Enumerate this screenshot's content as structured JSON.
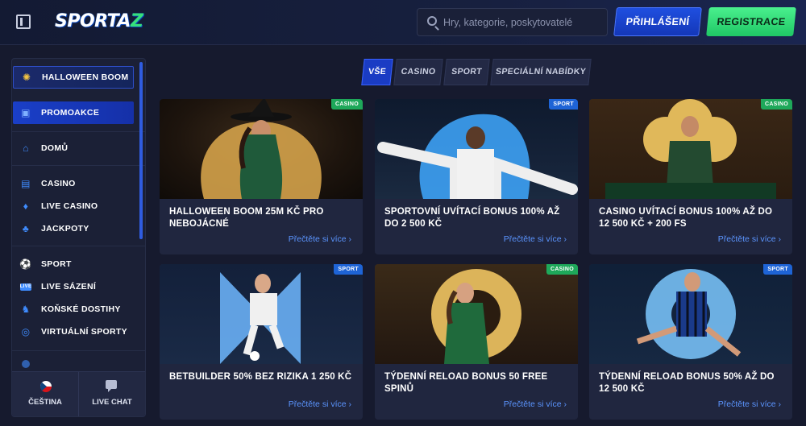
{
  "header": {
    "logo_text": "SPORTA",
    "logo_accent": "Z",
    "search_placeholder": "Hry, kategorie, poskytovatelé",
    "login_label": "PŘIHLÁŠENÍ",
    "register_label": "REGISTRACE"
  },
  "sidebar": {
    "items": [
      {
        "label": "HALLOWEEN BOOM",
        "icon": "halloween-icon"
      },
      {
        "label": "PROMOAKCE",
        "icon": "gift-icon"
      },
      {
        "label": "DOMŮ",
        "icon": "home-icon"
      },
      {
        "label": "CASINO",
        "icon": "slot-machine-icon"
      },
      {
        "label": "LIVE CASINO",
        "icon": "cards-icon"
      },
      {
        "label": "JACKPOTY",
        "icon": "clover-icon"
      },
      {
        "label": "SPORT",
        "icon": "soccer-ball-icon"
      },
      {
        "label": "LIVE SÁZENÍ",
        "icon": "live-icon"
      },
      {
        "label": "KOŇSKÉ DOSTIHY",
        "icon": "horse-icon"
      },
      {
        "label": "VIRTUÁLNÍ SPORTY",
        "icon": "virtual-sports-icon"
      }
    ],
    "language_label": "ČEŠTINA",
    "live_chat_label": "LIVE CHAT"
  },
  "tabs": [
    {
      "label": "VŠE",
      "selected": true
    },
    {
      "label": "CASINO",
      "selected": false
    },
    {
      "label": "SPORT",
      "selected": false
    },
    {
      "label": "SPECIÁLNÍ NABÍDKY",
      "selected": false
    }
  ],
  "cards": [
    {
      "title": "HALLOWEEN BOOM 25M KČ PRO NEBOJÁCNÉ",
      "badge": "CASINO",
      "link": "Přečtěte si více ›"
    },
    {
      "title": "SPORTOVNÍ UVÍTACÍ BONUS 100% AŽ DO 2 500 KČ",
      "badge": "SPORT",
      "link": "Přečtěte si více ›"
    },
    {
      "title": "CASINO UVÍTACÍ BONUS 100% AŽ DO 12 500 KČ + 200 FS",
      "badge": "CASINO",
      "link": "Přečtěte si více ›"
    },
    {
      "title": "BETBUILDER 50% BEZ RIZIKA 1 250 KČ",
      "badge": "SPORT",
      "link": "Přečtěte si více ›"
    },
    {
      "title": "TÝDENNÍ RELOAD BONUS 50 FREE SPINŮ",
      "badge": "CASINO",
      "link": "Přečtěte si více ›"
    },
    {
      "title": "TÝDENNÍ RELOAD BONUS 50% AŽ DO 12 500 KČ",
      "badge": "SPORT",
      "link": "Přečtěte si více ›"
    }
  ],
  "colors": {
    "accent_blue": "#1a3cc4",
    "register_green": "#2fd873",
    "casino_badge": "#1ea85a",
    "sport_badge": "#1e64d6",
    "link": "#5b95ff"
  }
}
